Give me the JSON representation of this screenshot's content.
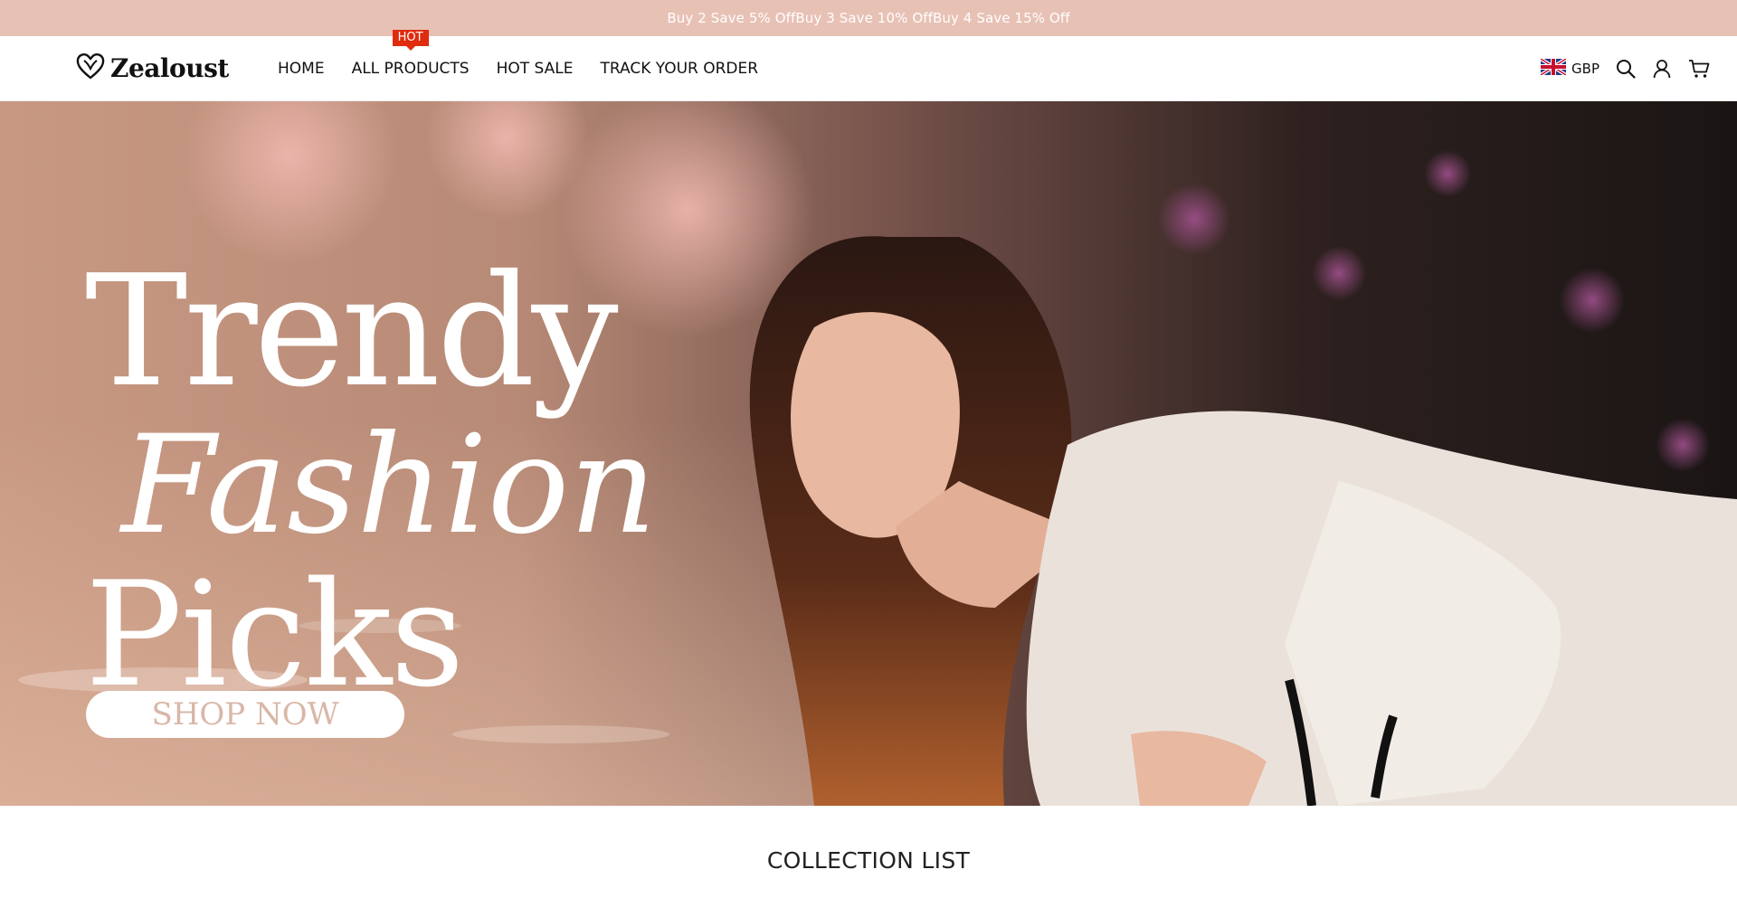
{
  "announcement": {
    "text": "Buy 2 Save 5% OffBuy 3 Save 10% OffBuy 4 Save 15% Off"
  },
  "header": {
    "logo_text": "Zealoust",
    "nav": [
      {
        "label": "HOME"
      },
      {
        "label": "ALL PRODUCTS",
        "badge": "HOT"
      },
      {
        "label": "HOT SALE"
      },
      {
        "label": "TRACK YOUR ORDER"
      }
    ],
    "currency": "GBP",
    "icons": [
      "uk-flag-icon",
      "search-icon",
      "account-icon",
      "cart-icon"
    ]
  },
  "hero": {
    "headline_line1": "Trendy",
    "headline_line2": "Fashion",
    "headline_line3": "Picks",
    "cta_label": "SHOP NOW"
  },
  "collection": {
    "title": "COLLECTION LIST"
  },
  "colors": {
    "announcement_bg": "#e8c1b5",
    "badge_red": "#e02b0e",
    "cta_text": "#d9b7a7"
  }
}
